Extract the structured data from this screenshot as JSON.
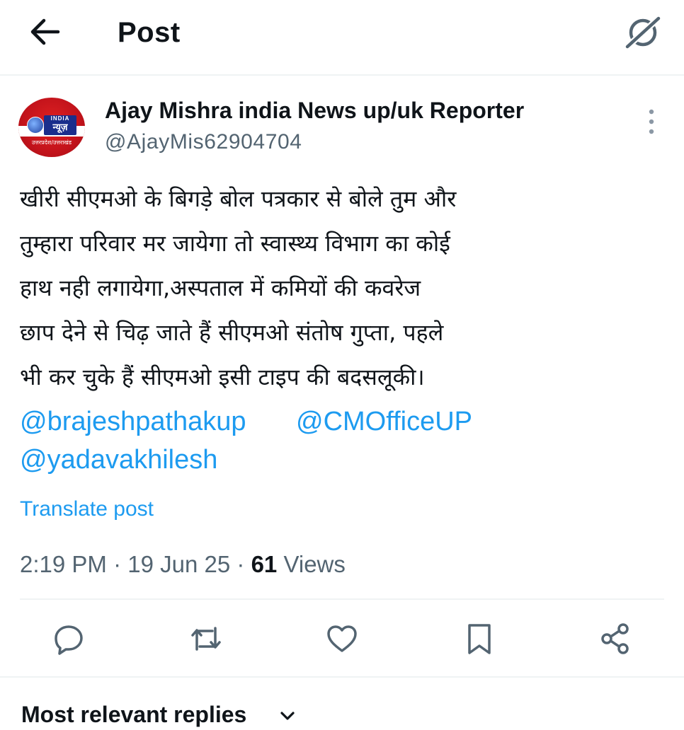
{
  "header": {
    "title": "Post",
    "back_icon": "arrow-left-icon",
    "grok_icon": "grok-icon"
  },
  "post": {
    "author_name": "Ajay Mishra india News up/uk Reporter",
    "author_handle": "@AjayMis62904704",
    "avatar": {
      "brand_top": "INDIA",
      "brand_main": "न्यूज़",
      "brand_sub": "उत्तरप्रदेश/उत्तराखंड"
    },
    "text_lines": [
      "खीरी सीएमओ के बिगड़े बोल पत्रकार से बोले तुम और",
      "तुम्हारा परिवार मर जायेगा तो स्वास्थ्य विभाग का कोई",
      "हाथ नही लगायेगा,अस्पताल में कमियों की कवरेज",
      "छाप देने से चिढ़ जाते हैं सीएमओ संतोष गुप्ता, पहले",
      "भी कर चुके हैं सीएमओ इसी टाइप की बदसलूकी।"
    ],
    "mentions": [
      "@brajeshpathakup",
      "@CMOfficeUP",
      "@yadavakhilesh"
    ],
    "translate_label": "Translate post",
    "time": "2:19 PM",
    "date": "19 Jun 25",
    "views_count": "61",
    "views_label": "Views",
    "separator": "·"
  },
  "actions": [
    "reply-icon",
    "repost-icon",
    "like-icon",
    "bookmark-icon",
    "share-icon"
  ],
  "replies_section": {
    "label": "Most relevant replies"
  },
  "colors": {
    "link": "#1d9bf0",
    "secondary_text": "#536471",
    "divider": "#eff3f4"
  }
}
